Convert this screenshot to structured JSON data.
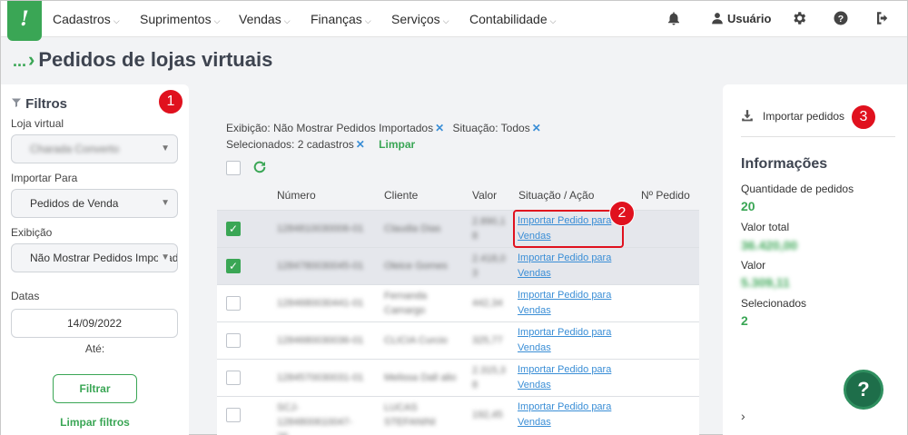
{
  "logo": "!",
  "nav": {
    "menus": [
      "Cadastros",
      "Suprimentos",
      "Vendas",
      "Finanças",
      "Serviços",
      "Contabilidade"
    ],
    "chevron": "⌵",
    "user": "Usuário",
    "icons": [
      "bell-icon",
      "user-icon",
      "gear-icon",
      "help-circle-icon",
      "logout-icon"
    ]
  },
  "page": {
    "breadcrumb": "...",
    "title": "Pedidos de lojas virtuais"
  },
  "filters": {
    "title": "Filtros",
    "loja_label": "Loja virtual",
    "loja_value": "Charada Converto",
    "importar_label": "Importar Para",
    "importar_value": "Pedidos de Venda",
    "exibicao_label": "Exibição",
    "exibicao_value": "Não Mostrar Pedidos Importados",
    "datas_label": "Datas",
    "data_inicio": "14/09/2022",
    "ate_label": "Até:",
    "filtrar": "Filtrar",
    "limpar": "Limpar filtros"
  },
  "badges": [
    "1",
    "2",
    "3"
  ],
  "chips": {
    "exibicao": "Exibição: Não Mostrar Pedidos Importados",
    "situacao": "Situação: Todos",
    "selecionados": "Selecionados: 2 cadastros",
    "x": "✕",
    "limpar": "Limpar"
  },
  "table": {
    "headers": [
      "Número",
      "Cliente",
      "Valor",
      "Situação / Ação",
      "Nº Pedido"
    ],
    "action_line1": "Importar Pedido para",
    "action_line2": "Vendas",
    "rows": [
      {
        "selected": true,
        "numero": "1284810030006-01",
        "cliente": "Claudia Dias",
        "valor": "2.890,1 8"
      },
      {
        "selected": true,
        "numero": "1284780030045-01",
        "cliente": "Oleice Gomes",
        "valor": "2.418,0 3"
      },
      {
        "selected": false,
        "numero": "1284680030441-01",
        "cliente": "Fernanda Camargo",
        "valor": "442,34"
      },
      {
        "selected": false,
        "numero": "1284680030036-01",
        "cliente": "CLICIA Curcio",
        "valor": "325,77"
      },
      {
        "selected": false,
        "numero": "1284570030031-01",
        "cliente": "Melissa Dall alio",
        "valor": "2.315,3 8"
      },
      {
        "selected": false,
        "numero": "SCJ-1284800610047-26",
        "cliente": "LUCAS STEFANINI",
        "valor": "192,45"
      }
    ]
  },
  "right": {
    "importar": "Importar pedidos",
    "info_title": "Informações",
    "qtd_label": "Quantidade de pedidos",
    "qtd_value": "20",
    "total_label": "Valor total",
    "total_value": "36.420,00",
    "valor_label": "Valor",
    "valor_value": "5.309,11",
    "sel_label": "Selecionados",
    "sel_value": "2",
    "help": "?",
    "chevron": "›"
  },
  "colors": {
    "brand": "#3aa655",
    "badge": "#e0111e",
    "link": "#3a8ed6"
  }
}
